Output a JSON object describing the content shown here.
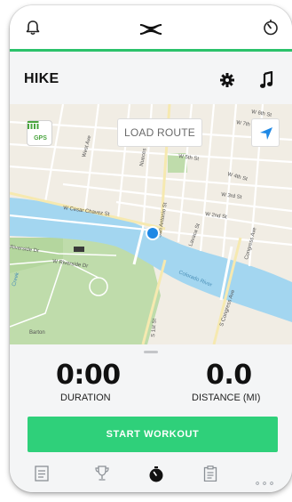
{
  "header": {
    "activity_title": "HIKE"
  },
  "map": {
    "load_route_label": "LOAD ROUTE",
    "gps_label": "GPS",
    "street_labels": {
      "w_cesar_chavez": "W Cesar Chavez St",
      "w_5th": "W 5th St",
      "w_4th": "W 4th St",
      "w_3rd": "W 3rd St",
      "w_2nd": "W 2nd St",
      "w_6th": "W 6th St",
      "w_7th": "W 7th St",
      "lavaca": "Lavaca St",
      "san_antonio": "San Antonio St",
      "nueces": "Nueces",
      "west_ave": "West Ave",
      "congress": "Congress Ave",
      "s_congress": "S Congress Ave",
      "s_1st": "S 1st St",
      "riverside": "Riverside Dr",
      "w_riverside": "W Riverside Dr",
      "colorado_river": "Colorado River",
      "barton": "Barton",
      "creek": "Creek"
    }
  },
  "stats": {
    "duration_value": "0:00",
    "duration_label": "DURATION",
    "distance_value": "0.0",
    "distance_label": "DISTANCE (MI)"
  },
  "actions": {
    "start_label": "START WORKOUT"
  },
  "colors": {
    "accent_green": "#2bc26b",
    "start_button": "#2fd07a",
    "river": "#9cd2ee",
    "park": "#b9d9a3",
    "location_dot": "#1e88e5"
  }
}
